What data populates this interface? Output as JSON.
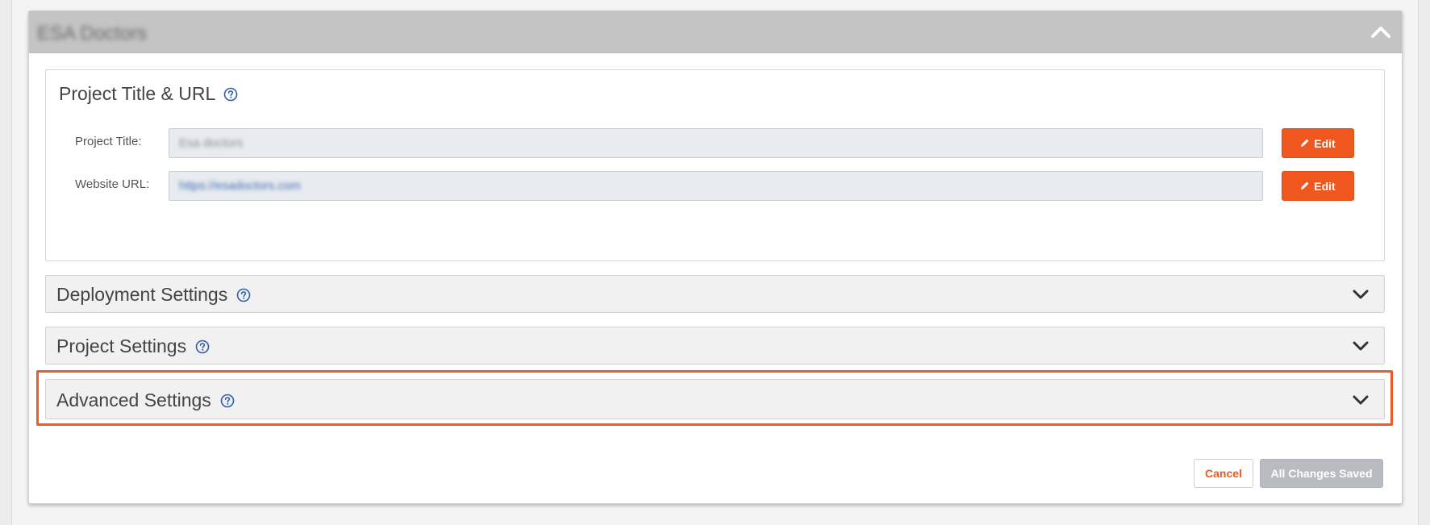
{
  "panel": {
    "title": "ESA Doctors"
  },
  "title_url_section": {
    "title": "Project Title & URL",
    "fields": [
      {
        "label": "Project Title:",
        "value": "Esa doctors",
        "edit_label": "Edit"
      },
      {
        "label": "Website URL:",
        "value": "https://esadoctors.com",
        "edit_label": "Edit"
      }
    ]
  },
  "sections": [
    {
      "title": "Deployment Settings"
    },
    {
      "title": "Project Settings"
    },
    {
      "title": "Advanced Settings",
      "highlighted": true
    }
  ],
  "footer": {
    "cancel_label": "Cancel",
    "saved_label": "All Changes Saved"
  },
  "colors": {
    "accent": "#f0571f",
    "help_icon": "#2f5da8",
    "highlight": "#ec5a28",
    "disabled_button": "#b8bcc1"
  },
  "icons": {
    "help": "question-circle-icon",
    "edit": "pencil-icon",
    "expand": "chevron-down-icon",
    "collapse": "chevron-up-icon"
  }
}
